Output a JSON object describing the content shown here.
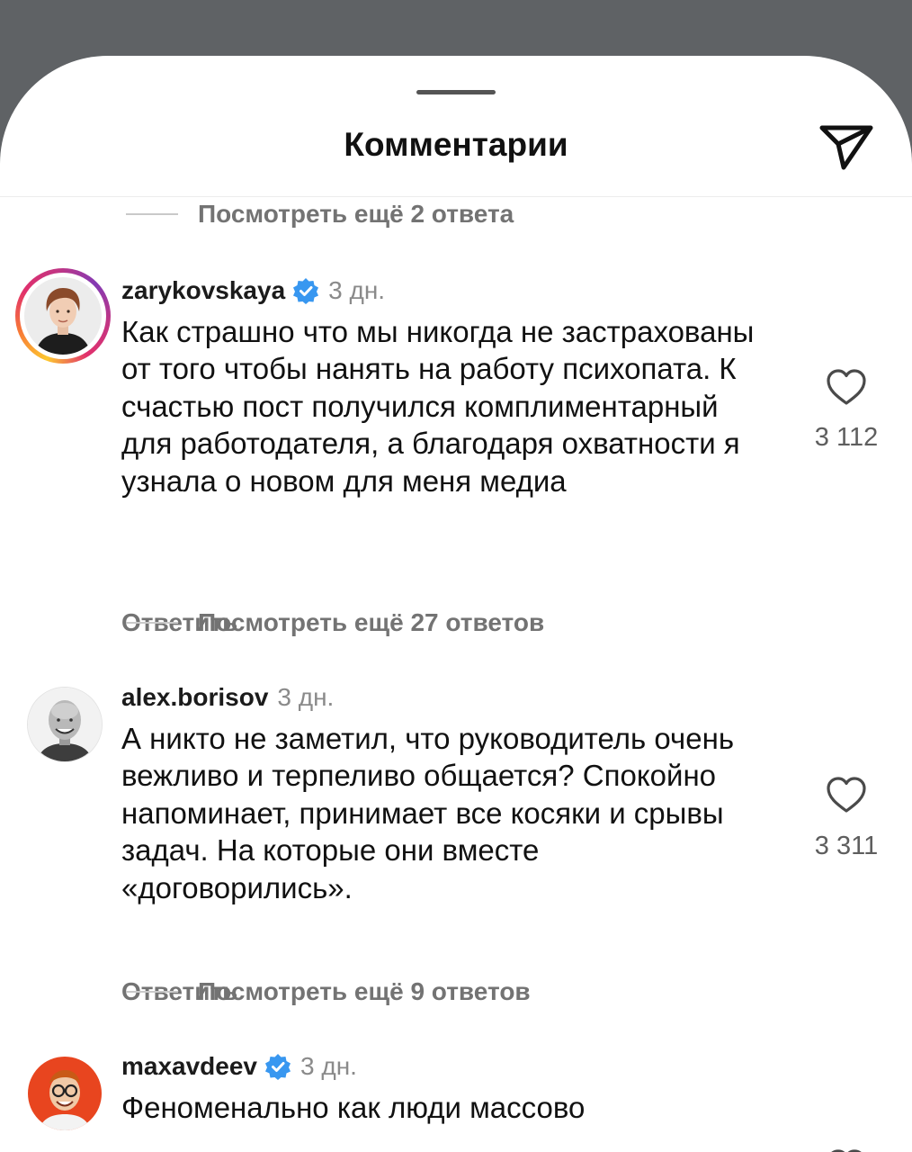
{
  "sheet": {
    "title": "Комментарии",
    "icons": {
      "share": "send-paper-plane-icon",
      "verified": "verified-badge-icon",
      "like": "heart-outline-icon"
    },
    "colors": {
      "verified": "#3897f0",
      "ring_from": "#fdc830",
      "ring_to": "#c13584"
    }
  },
  "view_more": [
    "Посмотреть ещё 2 ответа",
    "Посмотреть ещё 27 ответов",
    "Посмотреть ещё 9 ответов"
  ],
  "comments": [
    {
      "username": "zarykovskaya",
      "verified": true,
      "time": "3 дн.",
      "text": "Как страшно что мы никогда не застрахованы от того чтобы нанять на работу психопата. К счастью пост получился комплиментарный для работодателя, а благодаря охватности я узнала о новом для меня медиа",
      "reply_label": "Ответить",
      "likes": "3 112"
    },
    {
      "username": "alex.borisov",
      "verified": false,
      "time": "3 дн.",
      "text": "А никто не заметил, что руководитель очень вежливо и терпеливо общается? Спокойно напоминает, принимает все косяки и срывы задач. На которые они вместе «договорились».",
      "reply_label": "Ответить",
      "likes": "3 311"
    },
    {
      "username": "maxavdeev",
      "verified": true,
      "time": "3 дн.",
      "text": "Феноменально как люди массово"
    }
  ]
}
